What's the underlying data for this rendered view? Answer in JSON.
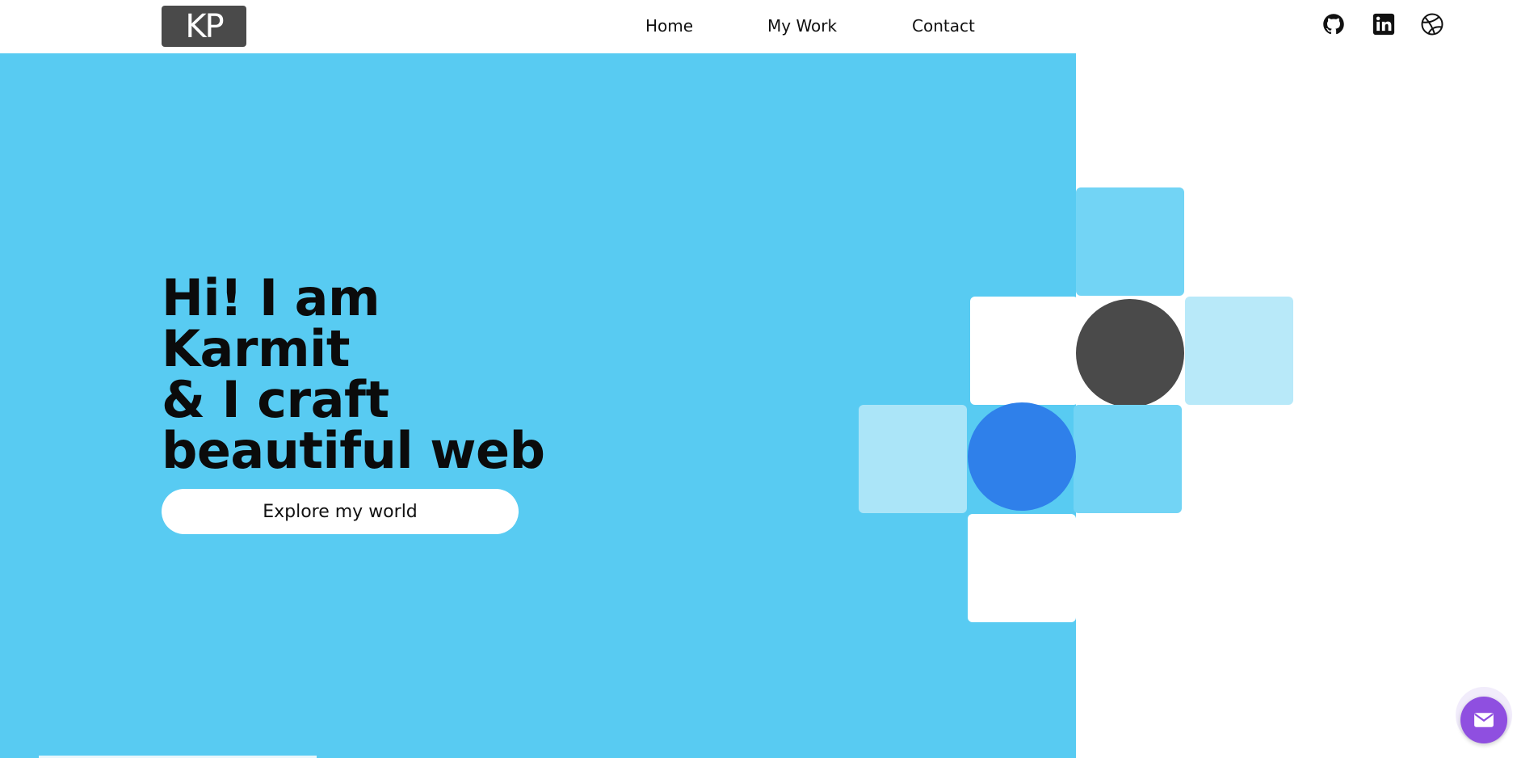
{
  "colors": {
    "hero_bg": "#58cbf2",
    "logo_bg": "#4a4a4a",
    "dark_circle": "#4a4a4a",
    "blue_circle": "#2f80ea",
    "tile_white": "#ffffff",
    "tile_medium": "#72d4f5",
    "tile_light": "#b8e9f9",
    "tile_lighter": "#abe5f8",
    "fab": "#8f4fe0"
  },
  "header": {
    "logo_text": "KP",
    "nav": {
      "home": "Home",
      "my_work": "My Work",
      "contact": "Contact"
    },
    "social_icons": [
      "github-icon",
      "linkedin-icon",
      "dribbble-icon"
    ]
  },
  "hero": {
    "title_line1": "Hi! I am Karmit",
    "title_line2": "& I craft",
    "title_line3": "beautiful web",
    "cta_label": "Explore my world"
  },
  "fab": {
    "icon": "mail-icon"
  }
}
